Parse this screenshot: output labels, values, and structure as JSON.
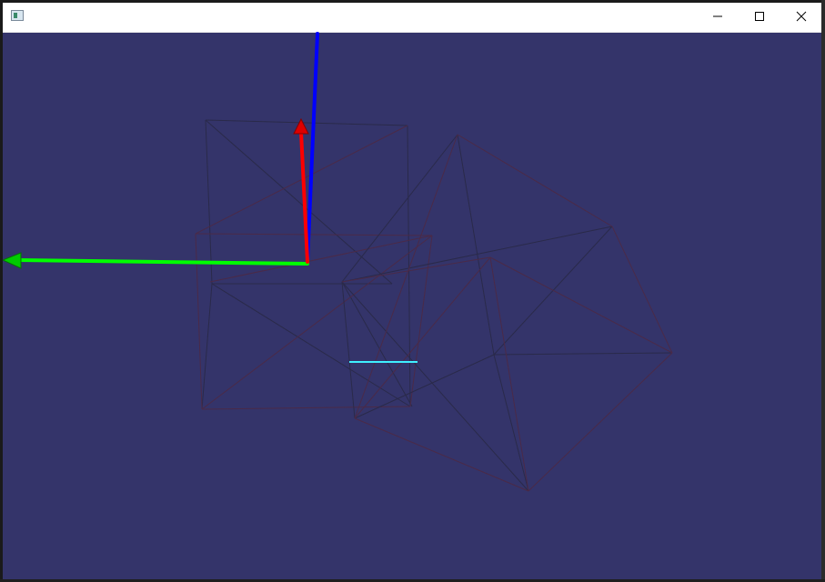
{
  "window": {
    "title": "",
    "controls": [
      {
        "name": "minimize",
        "icon": "minimize-icon"
      },
      {
        "name": "maximize",
        "icon": "maximize-icon"
      },
      {
        "name": "close",
        "icon": "close-icon"
      }
    ]
  },
  "scene": {
    "background_color": "#34346a",
    "axes": [
      {
        "name": "x-axis",
        "color": "#ff0000",
        "has_arrowhead": true
      },
      {
        "name": "y-axis",
        "color": "#00ff00",
        "has_arrowhead": true
      },
      {
        "name": "z-axis",
        "color": "#0000ff",
        "has_arrowhead": false
      }
    ],
    "wireframe_color": "#2a2a4a",
    "wireframe_alt_color": "#4a2a48",
    "marker_line_color": "#3ff0ff",
    "objects": [
      "wireframe-cube",
      "wireframe-octahedron",
      "cyan-marker-line"
    ]
  }
}
